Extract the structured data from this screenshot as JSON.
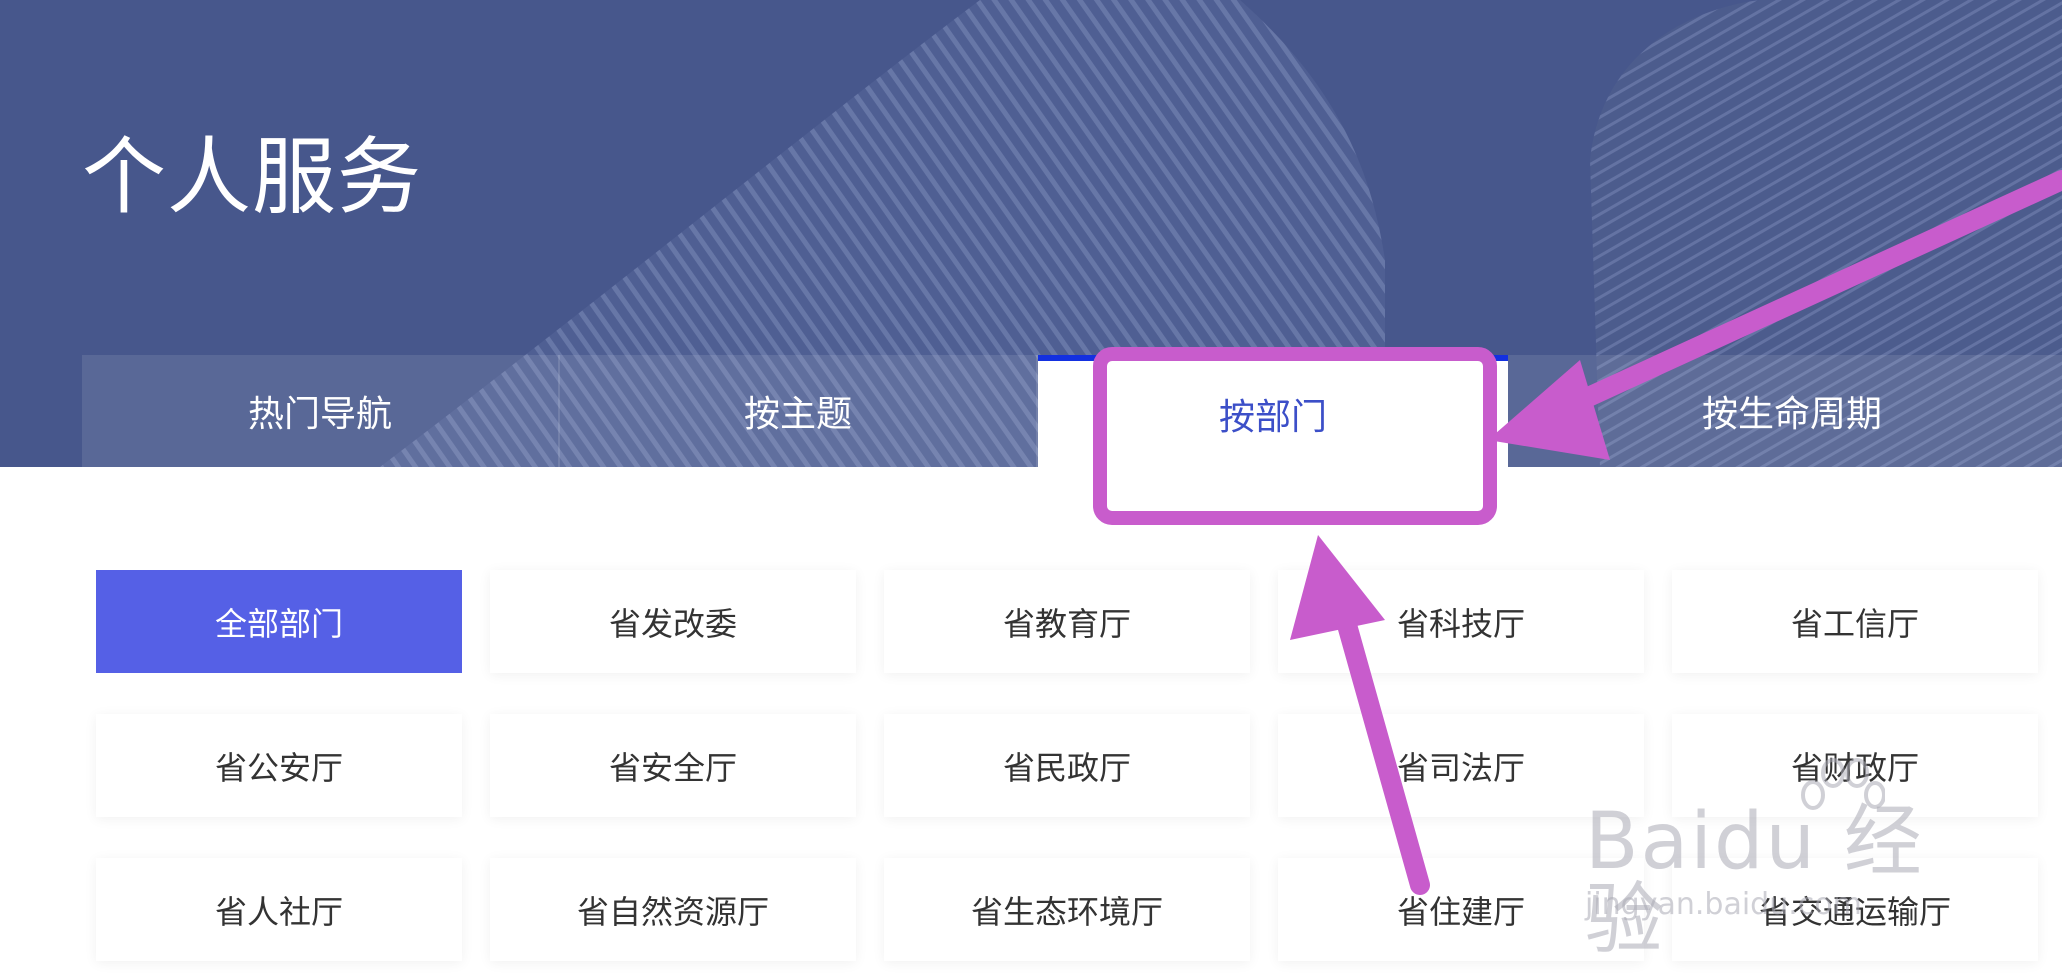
{
  "page": {
    "title": "个人服务"
  },
  "tabs": [
    {
      "label": "热门导航",
      "active": false
    },
    {
      "label": "按主题",
      "active": false
    },
    {
      "label": "按部门",
      "active": true
    },
    {
      "label": "按生命周期",
      "active": false
    }
  ],
  "departments": [
    "全部部门",
    "省发改委",
    "省教育厅",
    "省科技厅",
    "省工信厅",
    "省公安厅",
    "省安全厅",
    "省民政厅",
    "省司法厅",
    "省财政厅",
    "省人社厅",
    "省自然资源厅",
    "省生态环境厅",
    "省住建厅",
    "省交通运输厅"
  ],
  "watermark": {
    "brand": "Baidu 经验",
    "url": "jingyan.baidu.com"
  },
  "colors": {
    "hero": "#4a5a8e",
    "active_tab_text": "#3c4fc8",
    "active_tab_border": "#1330e0",
    "active_cell": "#5560e6",
    "annotation": "#c85ccc"
  }
}
